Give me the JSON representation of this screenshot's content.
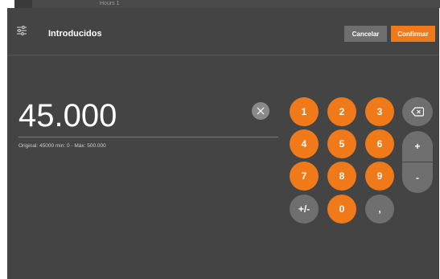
{
  "background": {
    "tab_label": "Hours 1"
  },
  "header": {
    "title": "Introducidos",
    "cancel_label": "Cancelar",
    "confirm_label": "Confirmar",
    "filter_icon": "filter-sliders-icon"
  },
  "display": {
    "value": "45.000",
    "info": "Original: 45000   min: 0 - Máx: 500.000",
    "clear_icon": "close-icon"
  },
  "keypad": {
    "rows": [
      [
        "1",
        "2",
        "3"
      ],
      [
        "4",
        "5",
        "6"
      ],
      [
        "7",
        "8",
        "9"
      ],
      [
        "+/-",
        "0",
        ","
      ]
    ],
    "backspace_icon": "backspace-icon",
    "plus": "+",
    "minus": "-"
  },
  "colors": {
    "accent": "#f07a1a",
    "panel": "#444444",
    "button_gray": "#6f6f6f"
  }
}
